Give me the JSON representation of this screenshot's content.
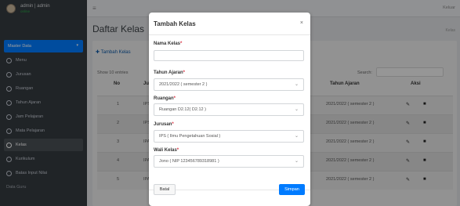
{
  "sidebar": {
    "user_name": "admin | admin",
    "user_status": "online",
    "items": [
      {
        "label": "Master Data"
      },
      {
        "label": "Menu"
      },
      {
        "label": "Jurusan"
      },
      {
        "label": "Ruangan"
      },
      {
        "label": "Tahun Ajaran"
      },
      {
        "label": "Jam Pelajaran"
      },
      {
        "label": "Mata Pelajaran"
      },
      {
        "label": "Kelas"
      },
      {
        "label": "Kurikulum"
      },
      {
        "label": "Batas Input Nilai"
      },
      {
        "label": "Data Guru"
      }
    ]
  },
  "topbar": {
    "logout": "Keluar"
  },
  "page": {
    "title": "Daftar Kelas",
    "breadcrumb": "Kelas"
  },
  "table_controls": {
    "add": "Tambah Kelas",
    "show": "Show",
    "show_value": "10",
    "entries": "entries",
    "search": "Search:"
  },
  "table": {
    "headers": {
      "no": "No",
      "jurusan": "Jur",
      "tahun": "Tahun Ajaran",
      "aksi": "Aksi"
    },
    "rows": [
      {
        "no": "1",
        "jur": "IPS",
        "tahun": "2021/2022 ( semester 2 )"
      },
      {
        "no": "2",
        "jur": "IPS",
        "tahun": "2021/2022 ( semester 2 )"
      },
      {
        "no": "3",
        "jur": "IPA",
        "tahun": "2021/2022 ( semester 2 )"
      },
      {
        "no": "4",
        "jur": "IPA",
        "tahun": "2021/2022 ( semester 2 )"
      },
      {
        "no": "5",
        "jur": "IPA",
        "tahun": "2021/2022 ( semester 2 )"
      }
    ]
  },
  "modal": {
    "title": "Tambah Kelas",
    "close": "×",
    "fields": {
      "nama_kelas": {
        "label": "Nama Kelas",
        "value": ""
      },
      "tahun_ajaran": {
        "label": "Tahun Ajaran",
        "value": "2021/2022 ( semester 2 )"
      },
      "ruangan": {
        "label": "Ruangan",
        "value": "Ruangan D2.12( D2.12 )"
      },
      "jurusan": {
        "label": "Jurusan",
        "value": "IPS ( Ilmu Pengetahuan Sosial )"
      },
      "wali_kelas": {
        "label": "Wali Kelas",
        "value": "Jono ( NIP 123456789318981 )"
      }
    },
    "required_mark": "*",
    "cancel": "Batal",
    "save": "Simpan"
  },
  "colors": {
    "primary": "#007bff",
    "sidebar_bg": "#343a40",
    "required": "#dc3545"
  },
  "icons": [
    "hamburger-icon",
    "chevron-down-icon",
    "plus-icon",
    "edit-icon",
    "trash-icon",
    "close-icon"
  ]
}
